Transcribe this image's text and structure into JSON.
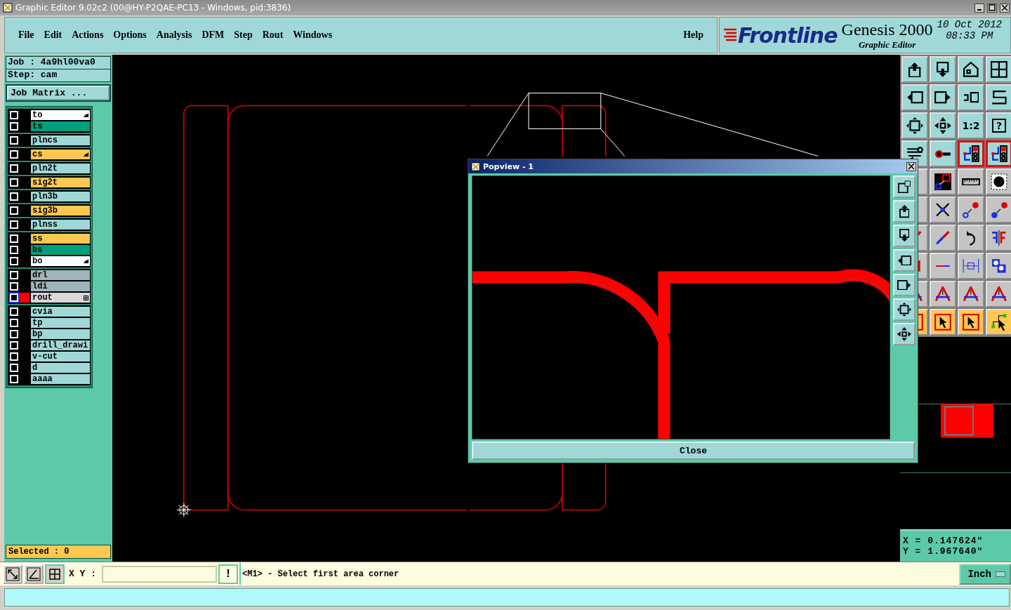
{
  "window": {
    "title": "Graphic Editor 9.02c2 (00@HY-P2QAE-PC13 - Windows, pid:3836)"
  },
  "menu": [
    {
      "label": "File"
    },
    {
      "label": "Edit"
    },
    {
      "label": "Actions"
    },
    {
      "label": "Options"
    },
    {
      "label": "Analysis"
    },
    {
      "label": "DFM"
    },
    {
      "label": "Step"
    },
    {
      "label": "Rout"
    },
    {
      "label": "Windows"
    }
  ],
  "help": "Help",
  "brand": {
    "logo": "Frontline",
    "product": "Genesis 2000",
    "subtitle": "Graphic Editor",
    "date": "10 Oct 2012",
    "time": "08:33 PM"
  },
  "job": {
    "job": "Job : 4a9hl00va0",
    "step": "Step: cam",
    "matrix_button": "Job Matrix ..."
  },
  "layer_groups": [
    [
      {
        "name": "to",
        "color": "#ffffff",
        "checked": false,
        "pointer": true,
        "work": false
      },
      {
        "name": "ts",
        "color": "#00a07c",
        "checked": false,
        "pointer": false,
        "work": false
      }
    ],
    [
      {
        "name": "plncs",
        "color": "#a0d8d8",
        "checked": false,
        "pointer": false,
        "work": false
      }
    ],
    [
      {
        "name": "cs",
        "color": "#ffc850",
        "checked": false,
        "pointer": true,
        "work": false
      }
    ],
    [
      {
        "name": "pln2t",
        "color": "#a0d8d8",
        "checked": false,
        "pointer": false,
        "work": false
      }
    ],
    [
      {
        "name": "sig2t",
        "color": "#ffc850",
        "checked": false,
        "pointer": false,
        "work": false
      }
    ],
    [
      {
        "name": "pln3b",
        "color": "#a0d8d8",
        "checked": false,
        "pointer": false,
        "work": false
      }
    ],
    [
      {
        "name": "sig3b",
        "color": "#ffc850",
        "checked": false,
        "pointer": false,
        "work": false
      }
    ],
    [
      {
        "name": "plnss",
        "color": "#a0d8d8",
        "checked": false,
        "pointer": false,
        "work": false
      }
    ],
    [
      {
        "name": "ss",
        "color": "#ffc850",
        "checked": false,
        "pointer": false,
        "work": false
      },
      {
        "name": "bs",
        "color": "#00a07c",
        "checked": false,
        "pointer": false,
        "work": false
      },
      {
        "name": "bo",
        "color": "#ffffff",
        "checked": false,
        "pointer": true,
        "work": false
      }
    ],
    [
      {
        "name": "drl",
        "color": "#a0b4bc",
        "checked": false,
        "pointer": false,
        "work": false
      },
      {
        "name": "ldi",
        "color": "#a0b4bc",
        "checked": false,
        "pointer": false,
        "work": false
      },
      {
        "name": "rout",
        "color": "#d8d8d8",
        "checked": false,
        "pointer": false,
        "work": true
      }
    ],
    [
      {
        "name": "cvia",
        "color": "#a0d8d8",
        "checked": false,
        "pointer": false,
        "work": false
      },
      {
        "name": "tp",
        "color": "#a0d8d8",
        "checked": false,
        "pointer": false,
        "work": false
      },
      {
        "name": "bp",
        "color": "#a0d8d8",
        "checked": false,
        "pointer": false,
        "work": false
      },
      {
        "name": "drill_drawi",
        "color": "#a0d8d8",
        "checked": false,
        "pointer": false,
        "work": false
      },
      {
        "name": "v-cut",
        "color": "#a0d8d8",
        "checked": false,
        "pointer": false,
        "work": false
      },
      {
        "name": "d",
        "color": "#a0d8d8",
        "checked": false,
        "pointer": false,
        "work": false
      },
      {
        "name": "aaaa",
        "color": "#a0d8d8",
        "checked": false,
        "pointer": false,
        "work": false
      }
    ]
  ],
  "selected": "Selected : 0",
  "tools": [
    {
      "kind": "view"
    },
    {
      "kind": "view"
    },
    {
      "kind": "view"
    },
    {
      "kind": "view"
    },
    {
      "kind": "view"
    },
    {
      "kind": "view"
    },
    {
      "kind": "view"
    },
    {
      "kind": "view"
    },
    {
      "kind": "view"
    },
    {
      "kind": "view"
    },
    {
      "kind": "view",
      "label": "1:2"
    },
    {
      "kind": "view",
      "label": "?"
    },
    {
      "kind": "view"
    },
    {
      "kind": "view"
    },
    {
      "kind": "highlight"
    },
    {
      "kind": "highlight"
    },
    {
      "kind": "edit"
    },
    {
      "kind": "edit"
    },
    {
      "kind": "edit"
    },
    {
      "kind": "edit"
    },
    {
      "kind": "edit"
    },
    {
      "kind": "edit"
    },
    {
      "kind": "edit"
    },
    {
      "kind": "edit"
    },
    {
      "kind": "edit"
    },
    {
      "kind": "edit"
    },
    {
      "kind": "edit"
    },
    {
      "kind": "edit"
    },
    {
      "kind": "edit"
    },
    {
      "kind": "edit"
    },
    {
      "kind": "edit"
    },
    {
      "kind": "edit"
    },
    {
      "kind": "edit"
    },
    {
      "kind": "edit"
    },
    {
      "kind": "edit"
    },
    {
      "kind": "edit"
    },
    {
      "kind": "select"
    },
    {
      "kind": "select"
    },
    {
      "kind": "select"
    },
    {
      "kind": "select"
    }
  ],
  "popup": {
    "title": "Popview - 1",
    "close_button": "Close"
  },
  "coords": {
    "x": "X = 0.147624\"",
    "y": "Y = 1.967640\""
  },
  "bottom": {
    "xy_label": "X Y :",
    "alert": "!",
    "message": "<M1> - Select first area corner",
    "units": "Inch"
  }
}
